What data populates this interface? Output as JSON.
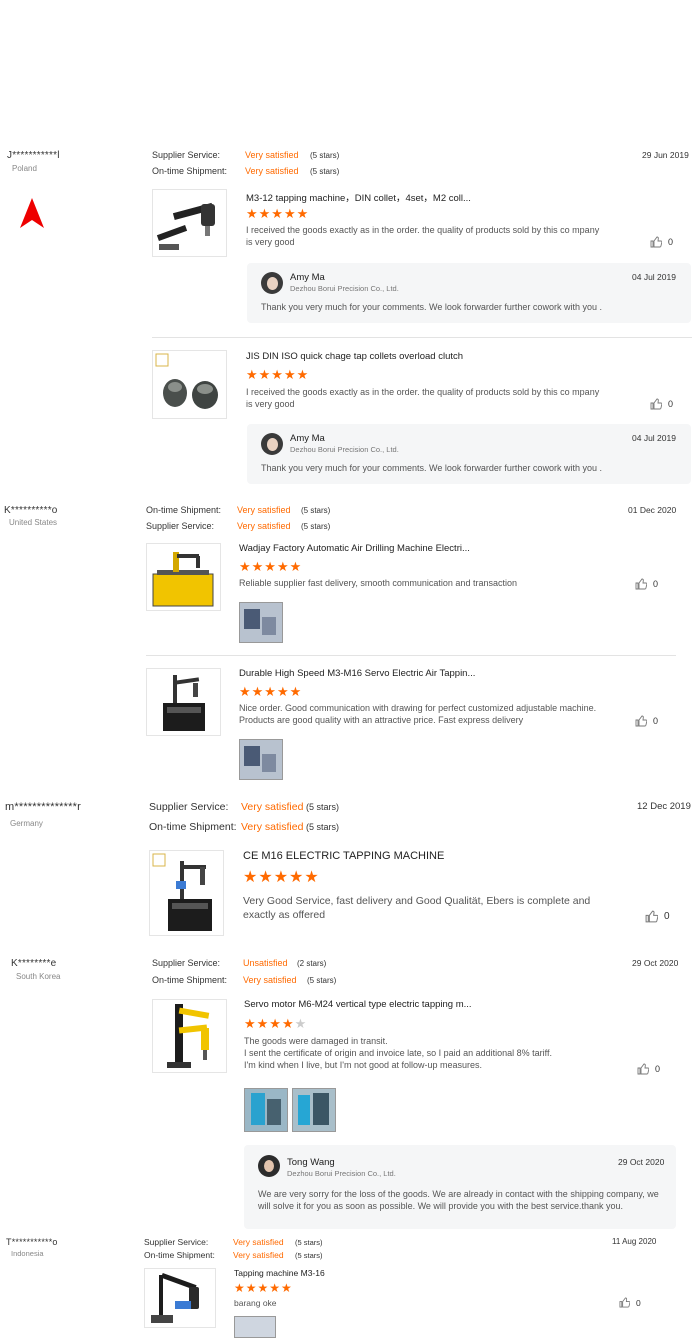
{
  "reviews": [
    {
      "buyer": "J***********l",
      "country": "Poland",
      "line1": {
        "label": "Supplier Service:",
        "value": "Very satisfied",
        "stars": "(5 stars)"
      },
      "line2": {
        "label": "On-time Shipment:",
        "value": "Very satisfied",
        "stars": "(5 stars)"
      },
      "date": "29 Jun 2019",
      "items": [
        {
          "title": "M3-12 tapping machine，DIN collet，4set，M2 coll...",
          "rating": 5,
          "text": "I received the goods exactly as in the order.  the quality of products sold by this co mpany is very good",
          "likes": "0",
          "reply": {
            "name": "Amy Ma",
            "company": "Dezhou Borui Precision Co., Ltd.",
            "date": "04 Jul 2019",
            "text": "Thank you very much for your comments. We look forwarder further cowork with you ."
          }
        },
        {
          "title": "JIS DIN ISO quick chage tap collets overload clutch",
          "rating": 5,
          "text": "I received the goods exactly as in the order.  the quality of products sold by this co mpany is very good",
          "likes": "0",
          "reply": {
            "name": "Amy Ma",
            "company": "Dezhou Borui Precision Co., Ltd.",
            "date": "04 Jul 2019",
            "text": "Thank you very much for your comments. We look forwarder further cowork with you ."
          }
        }
      ]
    },
    {
      "buyer": "K**********o",
      "country": "United States",
      "line1": {
        "label": "On-time Shipment:",
        "value": "Very satisfied",
        "stars": "(5 stars)"
      },
      "line2": {
        "label": "Supplier Service:",
        "value": "Very satisfied",
        "stars": "(5 stars)"
      },
      "date": "01 Dec 2020",
      "items": [
        {
          "title": "Wadjay Factory Automatic Air Drilling Machine Electri...",
          "rating": 5,
          "text": "Reliable supplier fast delivery, smooth communication and transaction",
          "likes": "0"
        },
        {
          "title": "Durable High Speed M3-M16 Servo Electric Air Tappin...",
          "rating": 5,
          "text": "Nice order. Good communication with drawing for perfect customized adjustable machine. Products are good quality with an attractive price. Fast express delivery",
          "likes": "0"
        }
      ]
    },
    {
      "buyer": "m**************r",
      "country": "Germany",
      "line1": {
        "label": "Supplier Service:",
        "value": "Very satisfied",
        "stars": "(5 stars)"
      },
      "line2": {
        "label": "On-time Shipment:",
        "value": "Very satisfied",
        "stars": "(5 stars)"
      },
      "date": "12 Dec 2019",
      "items": [
        {
          "title": "CE M16 ELECTRIC TAPPING MACHINE",
          "rating": 5,
          "text": "Very Good Service, fast delivery and Good Qualität, Ebers is complete and exactly as offered",
          "likes": "0"
        }
      ]
    },
    {
      "buyer": "K********e",
      "country": "South Korea",
      "line1": {
        "label": "Supplier Service:",
        "value": "Unsatisfied",
        "stars": "(2 stars)"
      },
      "line2": {
        "label": "On-time Shipment:",
        "value": "Very satisfied",
        "stars": "(5 stars)"
      },
      "date": "29 Oct 2020",
      "items": [
        {
          "title": "Servo motor M6-M24 vertical type electric tapping m...",
          "rating": 4,
          "text": "The goods were damaged in transit.\nI sent the certificate of origin and invoice late, so I paid an additional 8% tariff.\nI'm kind when I live, but I'm not good at follow-up measures.",
          "likes": "0",
          "reply": {
            "name": "Tong Wang",
            "company": "Dezhou Borui Precision Co., Ltd.",
            "date": "29 Oct 2020",
            "text": "We are very sorry for the loss of the goods. We are already in contact with the shipping company, we will solve it for you as soon as possible. We will provide you with the best service.thank you."
          }
        }
      ]
    },
    {
      "buyer": "T***********o",
      "country": "Indonesia",
      "line1": {
        "label": "Supplier Service:",
        "value": "Very satisfied",
        "stars": "(5 stars)"
      },
      "line2": {
        "label": "On-time Shipment:",
        "value": "Very satisfied",
        "stars": "(5 stars)"
      },
      "date": "11 Aug 2020",
      "items": [
        {
          "title": "Tapping machine M3-16",
          "rating": 5,
          "text": "barang oke",
          "likes": "0"
        }
      ]
    }
  ],
  "colors": {
    "accent": "#ff6a00",
    "reply_bg": "#f5f6f7",
    "star_off": "#cccccc"
  },
  "icons": {
    "like": "thumbs-up-icon",
    "marker": "red-arrow-icon",
    "star": "star-icon"
  }
}
